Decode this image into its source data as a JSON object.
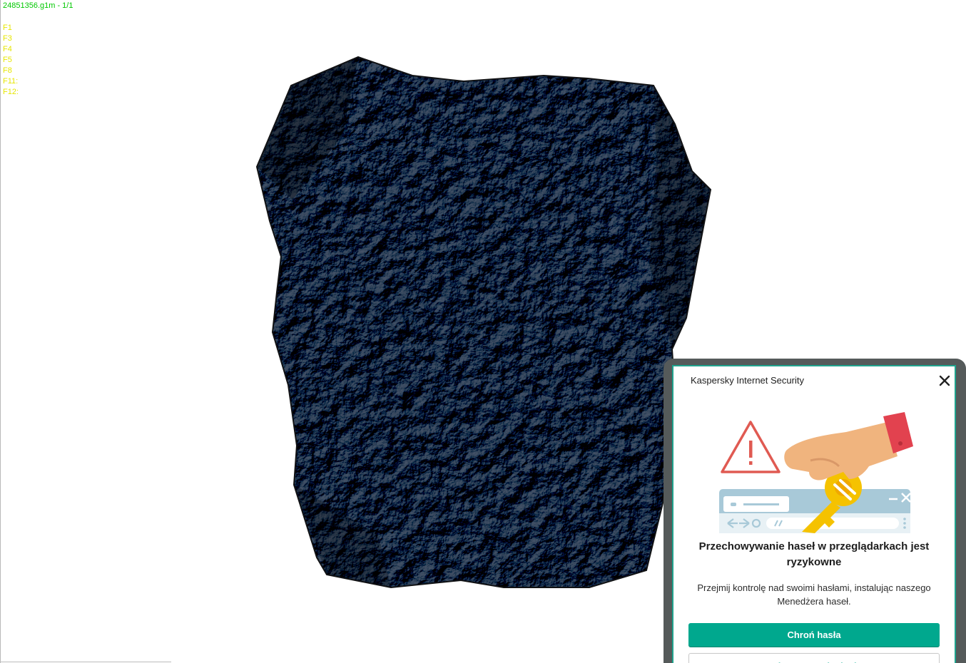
{
  "viewer": {
    "title": "24851356.g1m - 1/1",
    "title_color": "#00c800",
    "key_color": "#e6e600",
    "function_keys": [
      "F1",
      "F3",
      "F4",
      "F5",
      "F8",
      "F11:",
      "F12:"
    ],
    "model": "rock"
  },
  "popup": {
    "app_name": "Kaspersky Internet Security",
    "close_icon": "close-icon",
    "headline": "Przechowywanie haseł w przeglądarkach jest ryzykowne",
    "body": "Przejmij kontrolę nad swoimi hasłami, instalując naszego Menedżera haseł.",
    "primary_button": "Chroń hasła",
    "secondary_button": "Nie przypominaj mi",
    "accent_color": "#00a88e",
    "warning_color": "#e05a52"
  }
}
